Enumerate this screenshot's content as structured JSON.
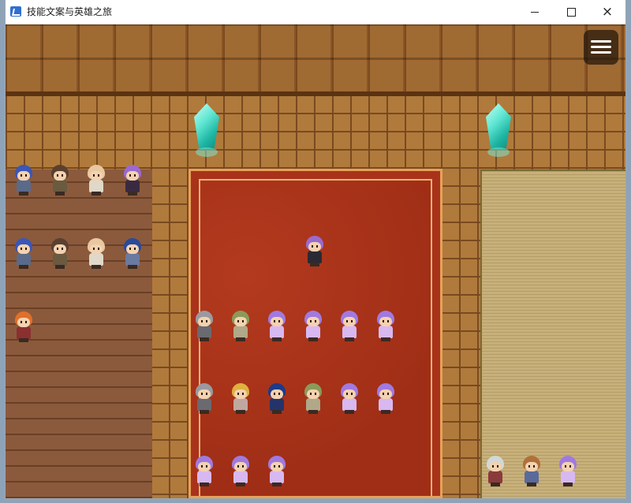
{
  "window": {
    "title": "技能文案与英雄之旅",
    "controls": {
      "minimize": "minimize",
      "maximize": "maximize",
      "close": "×"
    }
  },
  "menu": {
    "icon": "hamburger-menu-icon"
  },
  "scene": {
    "crystals": [
      {
        "name": "crystal-left",
        "color": "#5fe6d2"
      },
      {
        "name": "crystal-right",
        "color": "#5fe6d2"
      }
    ],
    "characters": [
      {
        "name": "npc-blue-hair-1",
        "hair": "#3a56b8",
        "body": "#5a6a8a"
      },
      {
        "name": "npc-brown-cap-1",
        "hair": "#5a4030",
        "body": "#6a5a40"
      },
      {
        "name": "npc-bald-1",
        "hair": "#e8c8a0",
        "body": "#e0d8c8"
      },
      {
        "name": "npc-purple-hair-1",
        "hair": "#9a6ad0",
        "body": "#3a2a40"
      },
      {
        "name": "npc-blue-hair-2",
        "hair": "#3a56b8",
        "body": "#5a6a8a"
      },
      {
        "name": "npc-brown-cap-2",
        "hair": "#5a4030",
        "body": "#6a5a40"
      },
      {
        "name": "npc-bald-2",
        "hair": "#e8c8a0",
        "body": "#e0d8c8"
      },
      {
        "name": "npc-blue-hair-3",
        "hair": "#2a4a9a",
        "body": "#6a7aa0"
      },
      {
        "name": "npc-orange-hair",
        "hair": "#e0702a",
        "body": "#8a3030"
      },
      {
        "name": "player-purple-hair",
        "hair": "#9a6ad0",
        "body": "#2a2a34"
      },
      {
        "name": "npc-knight-1",
        "hair": "#9a9aa0",
        "body": "#6a6a70"
      },
      {
        "name": "npc-elder-1",
        "hair": "#8a9a5a",
        "body": "#b0a888"
      },
      {
        "name": "npc-purple-girl-1",
        "hair": "#a07ae0",
        "body": "#d8b8f0"
      },
      {
        "name": "npc-purple-girl-2",
        "hair": "#a07ae0",
        "body": "#d8b8f0"
      },
      {
        "name": "npc-purple-girl-3",
        "hair": "#a07ae0",
        "body": "#d8b8f0"
      },
      {
        "name": "npc-purple-girl-4",
        "hair": "#a07ae0",
        "body": "#d8b8f0"
      },
      {
        "name": "npc-knight-2",
        "hair": "#9a9aa0",
        "body": "#6a6a70"
      },
      {
        "name": "npc-king",
        "hair": "#e0b040",
        "body": "#c0a8a0"
      },
      {
        "name": "npc-dark-knight",
        "hair": "#1e3a8a",
        "body": "#24346a"
      },
      {
        "name": "npc-elder-2",
        "hair": "#8a9a5a",
        "body": "#b0a888"
      },
      {
        "name": "npc-purple-girl-5",
        "hair": "#a07ae0",
        "body": "#d8b8f0"
      },
      {
        "name": "npc-purple-girl-6",
        "hair": "#a07ae0",
        "body": "#d8b8f0"
      },
      {
        "name": "npc-purple-girl-7",
        "hair": "#a07ae0",
        "body": "#d8b8f0"
      },
      {
        "name": "npc-purple-girl-8",
        "hair": "#a07ae0",
        "body": "#d8b8f0"
      },
      {
        "name": "npc-purple-girl-9",
        "hair": "#a07ae0",
        "body": "#d8b8f0"
      },
      {
        "name": "npc-white-hair",
        "hair": "#d0d8d8",
        "body": "#8a3a3a"
      },
      {
        "name": "npc-brown-hair",
        "hair": "#b0703a",
        "body": "#5a6a9a"
      },
      {
        "name": "npc-purple-girl-10",
        "hair": "#a07ae0",
        "body": "#d8b8f0"
      }
    ]
  }
}
